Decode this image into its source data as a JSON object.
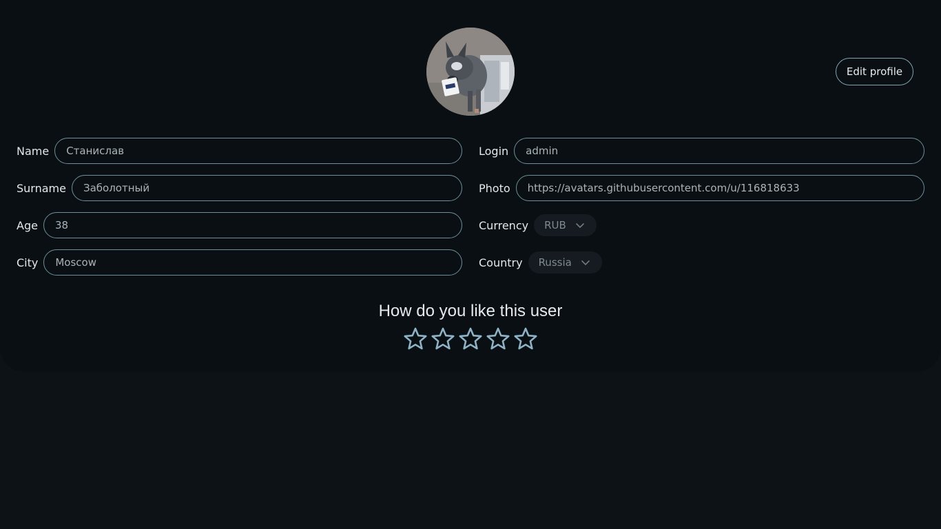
{
  "profile": {
    "edit_button": "Edit profile",
    "avatar_alt": "avatar"
  },
  "fields": {
    "name": {
      "label": "Name",
      "value": "Станислав"
    },
    "surname": {
      "label": "Surname",
      "value": "Заболотный"
    },
    "age": {
      "label": "Age",
      "value": "38"
    },
    "city": {
      "label": "City",
      "value": "Moscow"
    },
    "login": {
      "label": "Login",
      "value": "admin"
    },
    "photo": {
      "label": "Photo",
      "value": "https://avatars.githubusercontent.com/u/116818633"
    },
    "currency": {
      "label": "Currency",
      "value": "RUB"
    },
    "country": {
      "label": "Country",
      "value": "Russia"
    }
  },
  "rating": {
    "title": "How do you like this user",
    "max_stars": 5,
    "selected": 0
  },
  "colors": {
    "star_outline": "#8fb3c6",
    "input_border": "#6e8f99",
    "background": "#0d1216"
  },
  "icons": {
    "select_arrow": "chevron-down-icon",
    "rating": "star-outline-icon"
  }
}
